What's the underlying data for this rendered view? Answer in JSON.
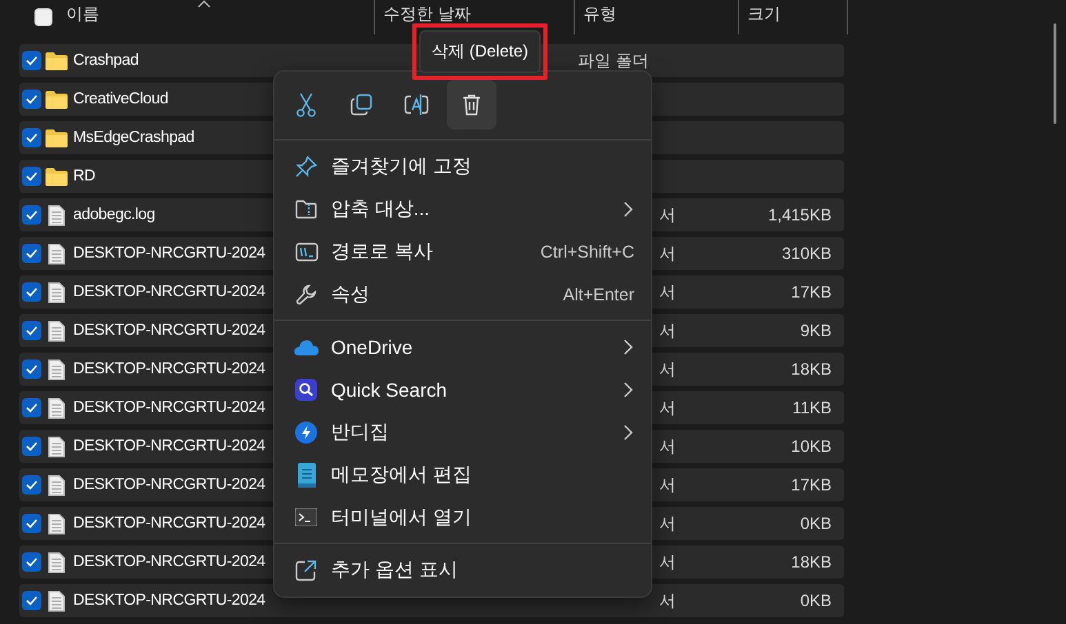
{
  "header": {
    "select_all_checked": false,
    "columns": [
      "이름",
      "수정한 날짜",
      "유형",
      "크기"
    ]
  },
  "rows": [
    {
      "kind": "folder",
      "name": "Crashpad",
      "checked": true,
      "type": "파일 폴더"
    },
    {
      "kind": "folder",
      "name": "CreativeCloud",
      "checked": true
    },
    {
      "kind": "folder",
      "name": "MsEdgeCrashpad",
      "checked": true
    },
    {
      "kind": "folder",
      "name": "RD",
      "checked": true
    },
    {
      "kind": "file",
      "name": "adobegc.log",
      "checked": true,
      "type": "서",
      "size": "1,415KB"
    },
    {
      "kind": "file",
      "name": "DESKTOP-NRCGRTU-2024",
      "checked": true,
      "type": "서",
      "size": "310KB"
    },
    {
      "kind": "file",
      "name": "DESKTOP-NRCGRTU-2024",
      "checked": true,
      "type": "서",
      "size": "17KB"
    },
    {
      "kind": "file",
      "name": "DESKTOP-NRCGRTU-2024",
      "checked": true,
      "type": "서",
      "size": "9KB"
    },
    {
      "kind": "file",
      "name": "DESKTOP-NRCGRTU-2024",
      "checked": true,
      "type": "서",
      "size": "18KB"
    },
    {
      "kind": "file",
      "name": "DESKTOP-NRCGRTU-2024",
      "checked": true,
      "type": "서",
      "size": "11KB"
    },
    {
      "kind": "file",
      "name": "DESKTOP-NRCGRTU-2024",
      "checked": true,
      "type": "서",
      "size": "10KB"
    },
    {
      "kind": "file",
      "name": "DESKTOP-NRCGRTU-2024",
      "checked": true,
      "type": "서",
      "size": "17KB"
    },
    {
      "kind": "file",
      "name": "DESKTOP-NRCGRTU-2024",
      "checked": true,
      "type": "서",
      "size": "0KB"
    },
    {
      "kind": "file",
      "name": "DESKTOP-NRCGRTU-2024",
      "checked": true,
      "type": "서",
      "size": "18KB"
    },
    {
      "kind": "file",
      "name": "DESKTOP-NRCGRTU-2024",
      "checked": true,
      "type": "서",
      "size": "0KB"
    }
  ],
  "context_menu": {
    "toolbar": [
      {
        "kind": "cut",
        "hovered": false
      },
      {
        "kind": "copy",
        "hovered": false
      },
      {
        "kind": "rename",
        "hovered": false
      },
      {
        "kind": "delete",
        "hovered": true
      }
    ],
    "sections": [
      [
        {
          "kind": "pin",
          "label": "즐겨찾기에 고정",
          "submenu": false
        },
        {
          "kind": "zip",
          "label": "압축 대상...",
          "submenu": true
        },
        {
          "kind": "path",
          "label": "경로로 복사",
          "shortcut": "Ctrl+Shift+C",
          "submenu": false
        },
        {
          "kind": "properties",
          "label": "속성",
          "shortcut": "Alt+Enter",
          "submenu": false
        }
      ],
      [
        {
          "kind": "cloud",
          "label": "OneDrive",
          "submenu": true
        },
        {
          "kind": "quicksearch",
          "label": "Quick Search",
          "submenu": true
        },
        {
          "kind": "bandizip",
          "label": "반디집",
          "submenu": true
        },
        {
          "kind": "notepad",
          "label": "메모장에서 편집",
          "submenu": false
        },
        {
          "kind": "terminal",
          "label": "터미널에서 열기",
          "submenu": false
        }
      ],
      [
        {
          "kind": "more",
          "label": "추가 옵션 표시",
          "submenu": false
        }
      ]
    ]
  },
  "tooltip": {
    "text": "삭제 (Delete)",
    "highlighted": true
  }
}
